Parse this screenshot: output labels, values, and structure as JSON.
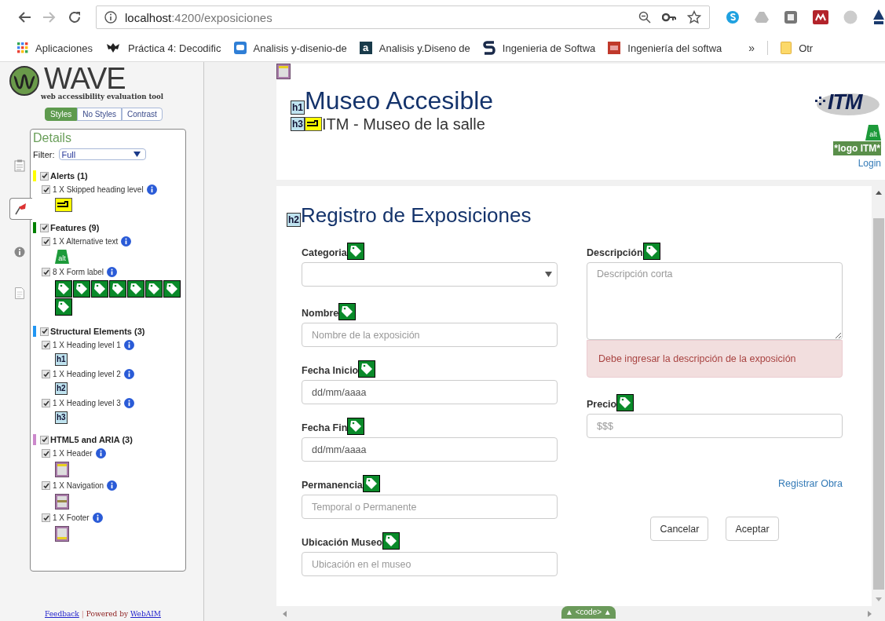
{
  "browser": {
    "url_host": "localhost",
    "url_path": ":4200/exposiciones",
    "bookmarks": [
      {
        "label": "Aplicaciones",
        "kind": "apps"
      },
      {
        "label": "Práctica 4: Decodific",
        "kind": "paw"
      },
      {
        "label": "Analisis y-disenio-de",
        "kind": "chat"
      },
      {
        "label": "Analisis y.Diseno de",
        "kind": "letter",
        "icon_text": "a"
      },
      {
        "label": "Ingenieria de Softwa",
        "kind": "swoosh"
      },
      {
        "label": "Ingeniería del softwa",
        "kind": "pdf"
      }
    ],
    "more": "»",
    "other_bookmarks": "Otr"
  },
  "wave": {
    "logo": "WAVE",
    "tagline": "web accessibility evaluation tool",
    "view_tabs": [
      {
        "label": "Styles",
        "selected": true
      },
      {
        "label": "No Styles",
        "selected": false
      },
      {
        "label": "Contrast",
        "selected": false
      }
    ],
    "side_tabs": [
      {
        "kind": "summary",
        "selected": false
      },
      {
        "kind": "details",
        "selected": true
      },
      {
        "kind": "reference",
        "selected": false
      },
      {
        "kind": "structure",
        "selected": false
      }
    ],
    "details_title": "Details",
    "filter_label": "Filter:",
    "filter_value": "Full",
    "categories": [
      {
        "title": "Alerts (1)",
        "color": "#ffff00",
        "checked": true,
        "items": [
          {
            "label": "1 X Skipped heading level",
            "checked": true,
            "icons": [
              {
                "kind": "skip"
              }
            ]
          }
        ]
      },
      {
        "title": "Features (9)",
        "color": "#008000",
        "checked": true,
        "items": [
          {
            "label": "1 X Alternative text",
            "checked": true,
            "icons": [
              {
                "kind": "alt",
                "text": "alt"
              }
            ]
          },
          {
            "label": "8 X Form label",
            "checked": true,
            "icons": [
              {
                "kind": "label"
              },
              {
                "kind": "label"
              },
              {
                "kind": "label"
              },
              {
                "kind": "label"
              },
              {
                "kind": "label"
              },
              {
                "kind": "label"
              },
              {
                "kind": "label"
              },
              {
                "kind": "label"
              }
            ]
          }
        ]
      },
      {
        "title": "Structural Elements (3)",
        "color": "#2196f3",
        "checked": true,
        "items": [
          {
            "label": "1 X Heading level 1",
            "checked": true,
            "icons": [
              {
                "kind": "heading",
                "text": "h1"
              }
            ]
          },
          {
            "label": "1 X Heading level 2",
            "checked": true,
            "icons": [
              {
                "kind": "heading",
                "text": "h2"
              }
            ]
          },
          {
            "label": "1 X Heading level 3",
            "checked": true,
            "icons": [
              {
                "kind": "heading",
                "text": "h3"
              }
            ]
          }
        ]
      },
      {
        "title": "HTML5 and ARIA (3)",
        "color": "#cc88cc",
        "checked": true,
        "items": [
          {
            "label": "1 X Header",
            "checked": true,
            "icons": [
              {
                "kind": "header"
              }
            ]
          },
          {
            "label": "1 X Navigation",
            "checked": true,
            "icons": [
              {
                "kind": "nav"
              }
            ]
          },
          {
            "label": "1 X Footer",
            "checked": true,
            "icons": [
              {
                "kind": "footer"
              }
            ]
          }
        ]
      }
    ],
    "feedback_link": "Feedback",
    "separator": "|",
    "powered_by": "Powered by",
    "webaim_link": "WebAIM"
  },
  "page": {
    "header": {
      "h1_badge": "h1",
      "title": "Museo Accesible",
      "h3_badge": "h3",
      "subtitle": "ITM - Museo de la salle",
      "logo_text": "ITM",
      "alt_badge": "alt",
      "logo_alt": "*logo ITM*",
      "login": "Login"
    },
    "form": {
      "h2_badge": "h2",
      "heading": "Registro de Exposiciones",
      "left_fields": [
        {
          "label": "Categoria",
          "kind": "select"
        },
        {
          "label": "Nombre",
          "kind": "input",
          "placeholder": "Nombre de la exposición"
        },
        {
          "label": "Fecha Inicio",
          "kind": "input",
          "value": "dd/mm/aaaa"
        },
        {
          "label": "Fecha Fin",
          "kind": "input",
          "value": "dd/mm/aaaa"
        },
        {
          "label": "Permanencia",
          "kind": "input",
          "placeholder": "Temporal o Permanente"
        },
        {
          "label": "Ubicación Museo",
          "kind": "input",
          "placeholder": "Ubicación en el museo"
        }
      ],
      "right_fields": [
        {
          "label": "Descripción",
          "kind": "textarea",
          "placeholder": "Descripción corta",
          "error": "Debe ingresar la descripción de la exposición"
        },
        {
          "label": "Precio",
          "kind": "input",
          "placeholder": "$$$"
        }
      ],
      "link": "Registrar Obra",
      "buttons": [
        "Cancelar",
        "Aceptar"
      ]
    },
    "code_toggle": "▲ <code> ▲"
  }
}
